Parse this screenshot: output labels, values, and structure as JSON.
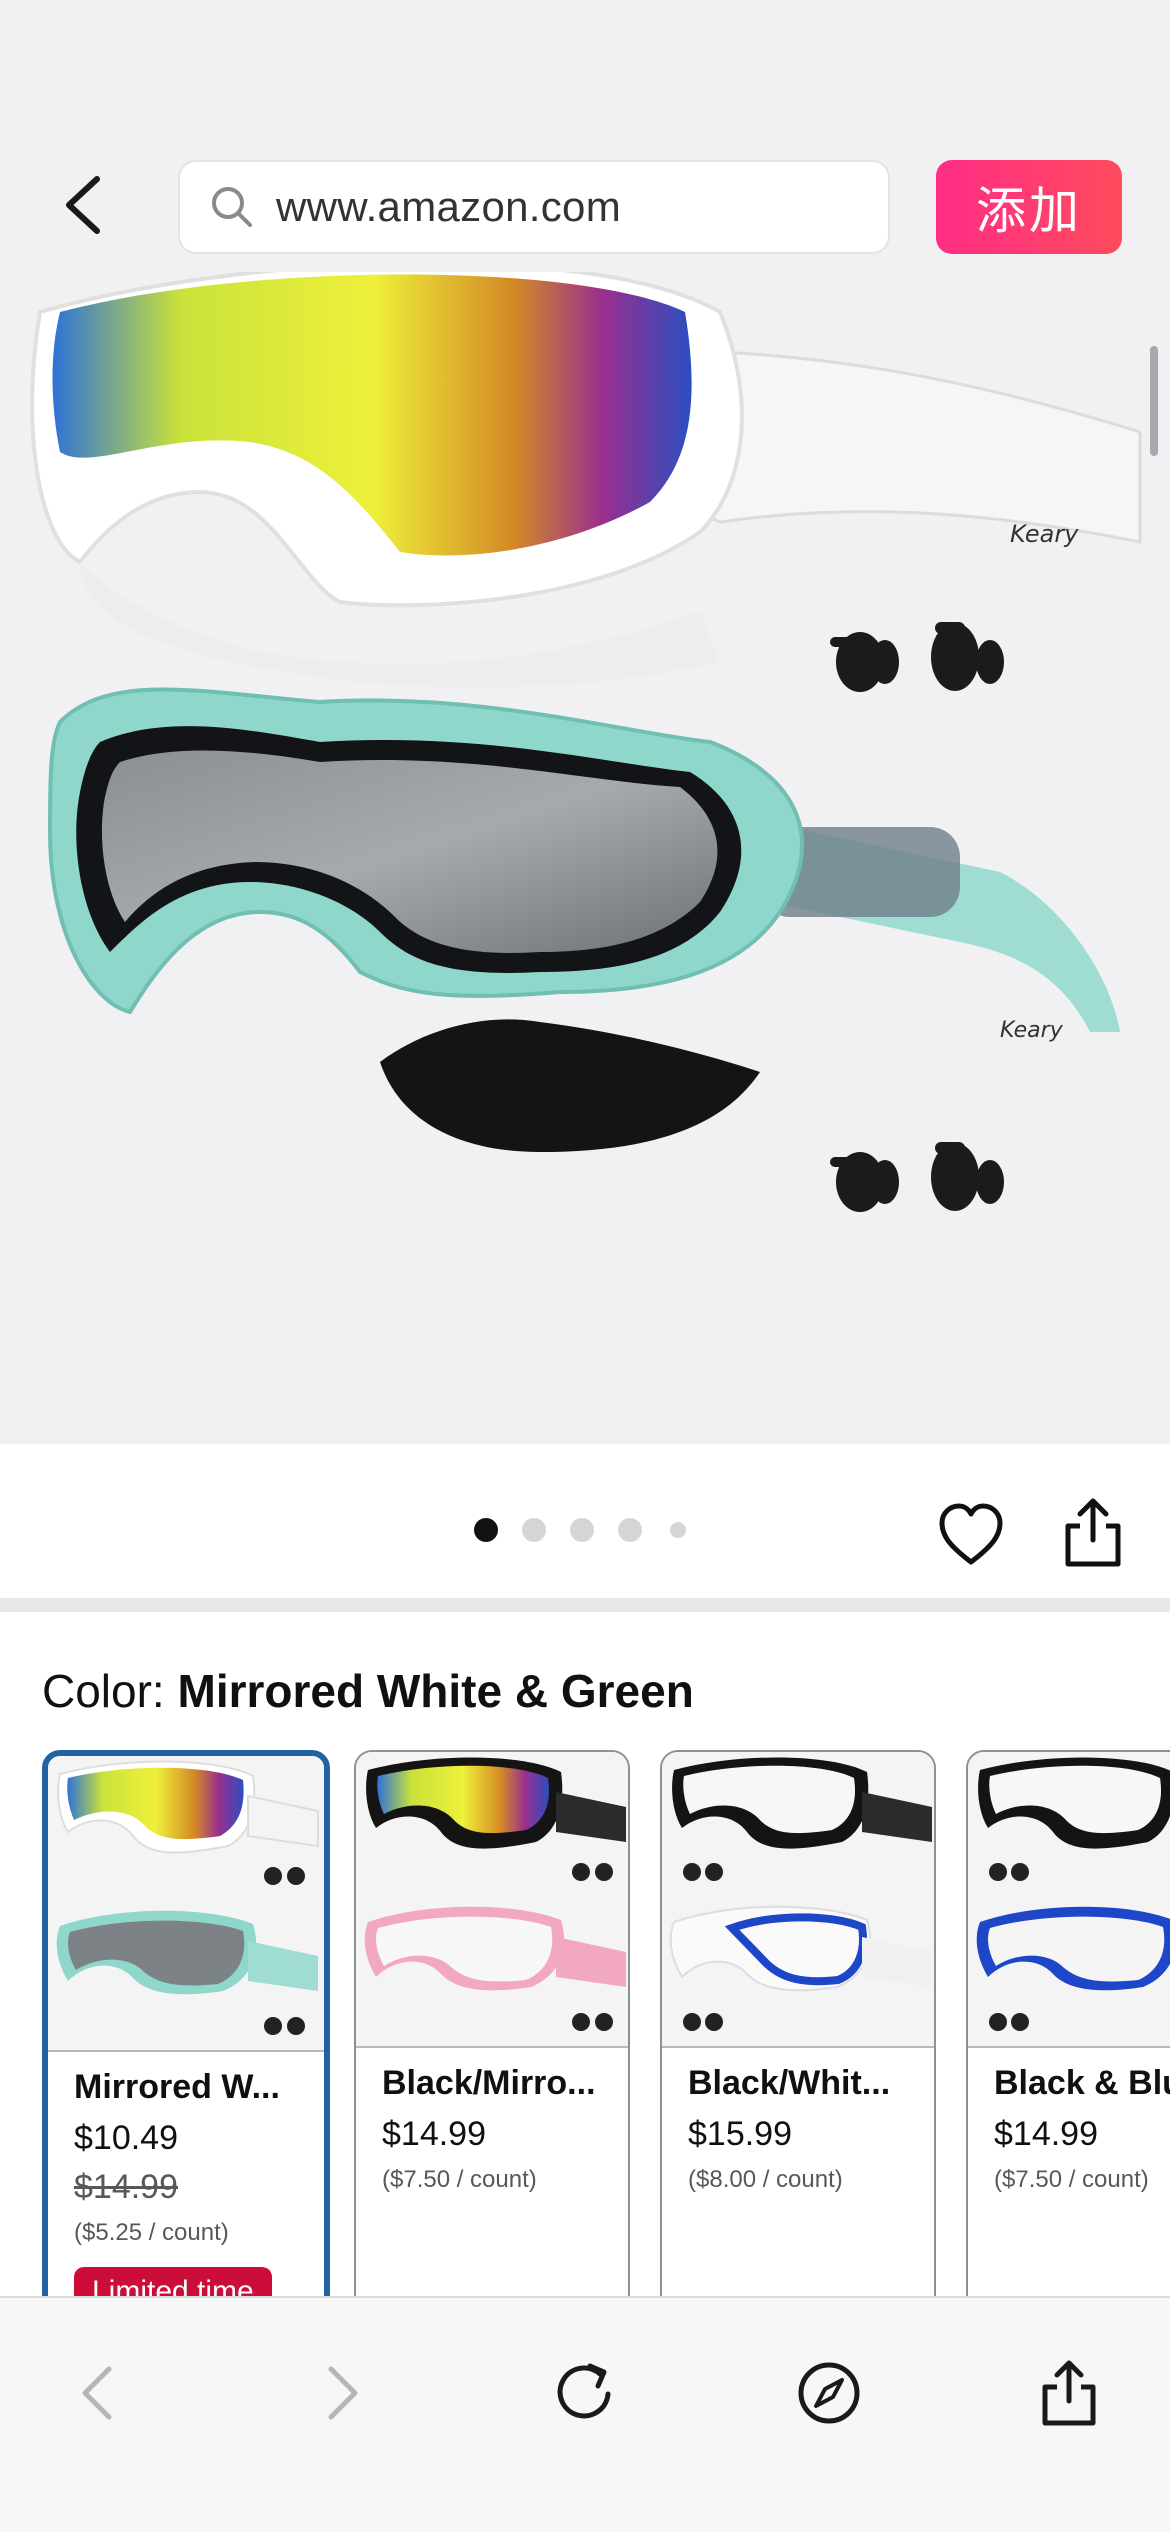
{
  "browser": {
    "url": "www.amazon.com",
    "add_button_label": "添加"
  },
  "product": {
    "images_count": 5,
    "active_image_index": 0,
    "brand_mark": "Keary"
  },
  "colors": {
    "label": "Color:",
    "selected_value": "Mirrored White & Green",
    "options": [
      {
        "name": "Mirrored W...",
        "price": "$10.49",
        "list_price": "$14.99",
        "unit_price": "($5.25 / count)",
        "badge": "Limited time"
      },
      {
        "name": "Black/Mirro...",
        "price": "$14.99",
        "unit_price": "($7.50 / count)"
      },
      {
        "name": "Black/Whit...",
        "price": "$15.99",
        "unit_price": "($8.00 / count)"
      },
      {
        "name": "Black & Blu",
        "price": "$14.99",
        "unit_price": "($7.50 / count)"
      }
    ]
  },
  "theme": {
    "accent_pink": "#ff2d86",
    "selected_border": "#2162a1",
    "badge_red": "#cc0c39"
  },
  "toolbar": {
    "icons": [
      "back-icon",
      "forward-icon",
      "reload-icon",
      "compass-icon",
      "share-icon"
    ]
  }
}
